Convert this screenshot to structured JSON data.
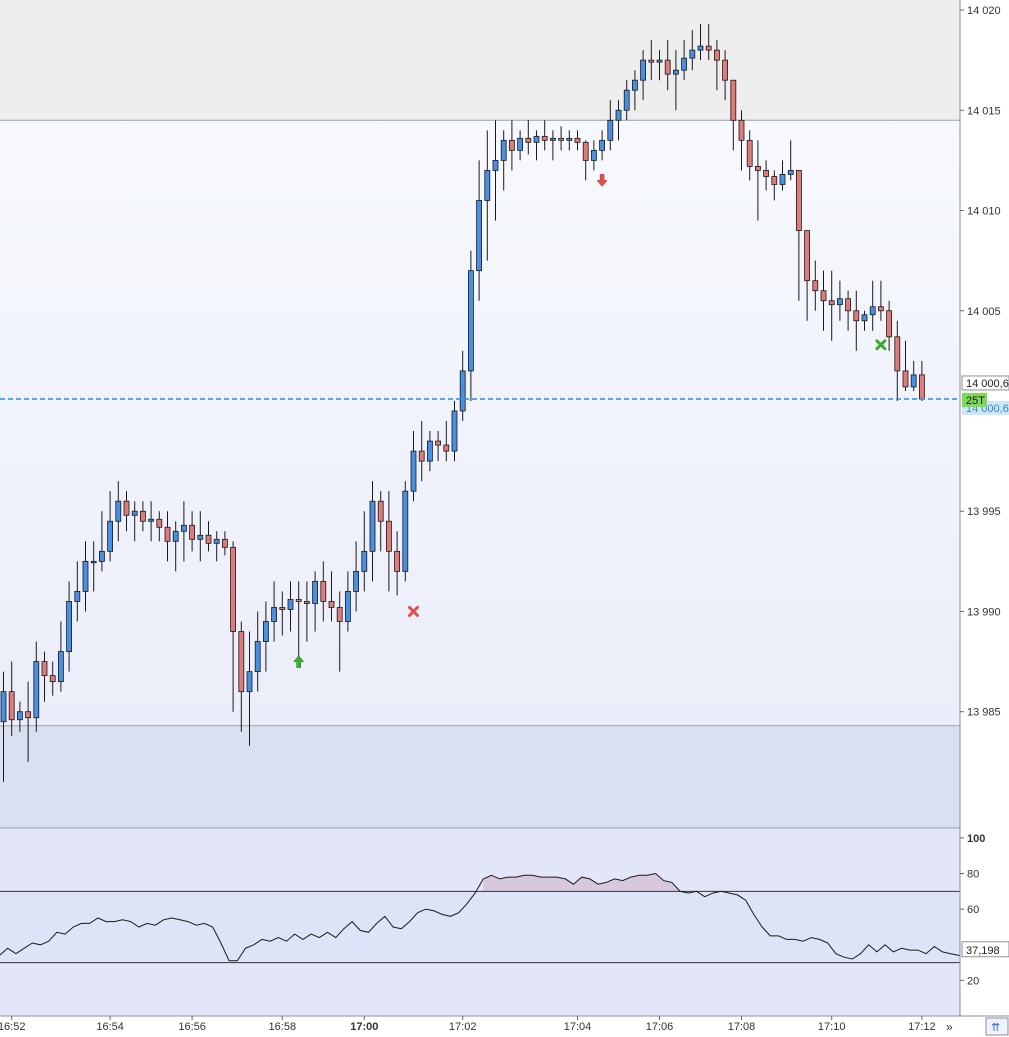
{
  "chart_data": [
    {
      "type": "candlestick",
      "symbol_tag": "25T",
      "y_ticks": [
        "14 020",
        "14 015",
        "14 010",
        "14 005",
        "13 995",
        "13 990",
        "13 985"
      ],
      "y_tick_values": [
        14020,
        14015,
        14010,
        14005,
        13995,
        13990,
        13985
      ],
      "ylim": [
        13979.2,
        14020.5
      ],
      "x_ticks": [
        {
          "label": "16:52",
          "bar": 1,
          "bold": false
        },
        {
          "label": "16:54",
          "bar": 13,
          "bold": false
        },
        {
          "label": "16:56",
          "bar": 23,
          "bold": false
        },
        {
          "label": "16:58",
          "bar": 34,
          "bold": false
        },
        {
          "label": "17:00",
          "bar": 44,
          "bold": true
        },
        {
          "label": "17:02",
          "bar": 56,
          "bold": false
        },
        {
          "label": "17:04",
          "bar": 70,
          "bold": false
        },
        {
          "label": "17:06",
          "bar": 80,
          "bold": false
        },
        {
          "label": "17:08",
          "bar": 90,
          "bold": false
        },
        {
          "label": "17:10",
          "bar": 101,
          "bold": false
        },
        {
          "label": "17:12",
          "bar": 112,
          "bold": false
        }
      ],
      "last_price": "14 000,6",
      "last_price_value": 14000.6,
      "upper_zone_from": 14014.5,
      "lower_zone_to": 13984.3,
      "colors": {
        "up": "#4a90e2",
        "down": "#e07b7b",
        "outline": "#1a1a1a",
        "level": "#2a8bd8",
        "tag": "#7ed957"
      },
      "candles": [
        [
          13984.5,
          13987.0,
          13981.5,
          13986.0
        ],
        [
          13986.0,
          13987.5,
          13983.8,
          13984.6
        ],
        [
          13984.6,
          13985.5,
          13984.0,
          13985.0
        ],
        [
          13985.0,
          13986.5,
          13982.5,
          13984.7
        ],
        [
          13984.7,
          13988.5,
          13984.0,
          13987.5
        ],
        [
          13987.5,
          13988.0,
          13985.5,
          13986.8
        ],
        [
          13986.8,
          13987.5,
          13985.8,
          13986.5
        ],
        [
          13986.5,
          13989.5,
          13986.0,
          13988.0
        ],
        [
          13988.0,
          13991.5,
          13987.0,
          13990.5
        ],
        [
          13990.5,
          13992.5,
          13989.5,
          13991.0
        ],
        [
          13991.0,
          13993.5,
          13990.0,
          13992.5
        ],
        [
          13992.5,
          13993.5,
          13991.0,
          13992.5
        ],
        [
          13992.5,
          13995.0,
          13992.0,
          13993.0
        ],
        [
          13993.0,
          13996.0,
          13992.5,
          13994.5
        ],
        [
          13994.5,
          13996.5,
          13993.5,
          13995.5
        ],
        [
          13995.5,
          13996.0,
          13994.0,
          13994.8
        ],
        [
          13994.8,
          13995.5,
          13993.5,
          13995.0
        ],
        [
          13995.0,
          13995.5,
          13994.0,
          13994.5
        ],
        [
          13994.5,
          13995.5,
          13993.5,
          13994.6
        ],
        [
          13994.6,
          13995.0,
          13993.5,
          13994.2
        ],
        [
          13994.2,
          13995.0,
          13992.5,
          13993.5
        ],
        [
          13993.5,
          13994.5,
          13992.0,
          13994.0
        ],
        [
          13994.0,
          13995.5,
          13992.5,
          13994.3
        ],
        [
          13994.3,
          13995.0,
          13993.0,
          13993.6
        ],
        [
          13993.6,
          13995.0,
          13992.5,
          13993.8
        ],
        [
          13993.8,
          13994.5,
          13993.0,
          13993.4
        ],
        [
          13993.4,
          13994.0,
          13992.5,
          13993.6
        ],
        [
          13993.6,
          13994.0,
          13992.8,
          13993.2
        ],
        [
          13993.2,
          13993.5,
          13985.0,
          13989.0
        ],
        [
          13989.0,
          13989.5,
          13984.0,
          13986.0
        ],
        [
          13986.0,
          13989.0,
          13983.3,
          13987.0
        ],
        [
          13987.0,
          13990.0,
          13986.0,
          13988.5
        ],
        [
          13988.5,
          13990.5,
          13987.0,
          13989.5
        ],
        [
          13989.5,
          13991.5,
          13988.5,
          13990.2
        ],
        [
          13990.2,
          13991.0,
          13988.8,
          13990.1
        ],
        [
          13990.1,
          13991.5,
          13989.0,
          13990.6
        ],
        [
          13990.6,
          13991.5,
          13987.5,
          13990.5
        ],
        [
          13990.5,
          13991.5,
          13988.5,
          13990.4
        ],
        [
          13990.4,
          13992.0,
          13989.0,
          13991.5
        ],
        [
          13991.5,
          13992.5,
          13989.5,
          13990.5
        ],
        [
          13990.5,
          13992.0,
          13989.5,
          13990.2
        ],
        [
          13990.2,
          13991.0,
          13987.0,
          13989.5
        ],
        [
          13989.5,
          13992.0,
          13989.0,
          13991.0
        ],
        [
          13991.0,
          13993.5,
          13990.0,
          13992.0
        ],
        [
          13992.0,
          13995.0,
          13991.0,
          13993.0
        ],
        [
          13993.0,
          13996.5,
          13991.5,
          13995.5
        ],
        [
          13995.5,
          13996.0,
          13993.0,
          13994.5
        ],
        [
          13994.5,
          13996.0,
          13991.0,
          13993.0
        ],
        [
          13993.0,
          13994.0,
          13990.8,
          13992.0
        ],
        [
          13992.0,
          13996.5,
          13991.5,
          13996.0
        ],
        [
          13996.0,
          13999.0,
          13995.5,
          13998.0
        ],
        [
          13998.0,
          13999.5,
          13996.5,
          13997.5
        ],
        [
          13997.5,
          13999.0,
          13997.0,
          13998.5
        ],
        [
          13998.5,
          13999.0,
          13997.5,
          13998.3
        ],
        [
          13998.3,
          13999.5,
          13997.5,
          13998.0
        ],
        [
          13998.0,
          14000.5,
          13997.5,
          14000.0
        ],
        [
          14000.0,
          14003.0,
          13999.5,
          14002.0
        ],
        [
          14002.0,
          14008.0,
          14000.5,
          14007.0
        ],
        [
          14007.0,
          14012.5,
          14005.5,
          14010.5
        ],
        [
          14010.5,
          14014.0,
          14007.5,
          14012.0
        ],
        [
          14012.0,
          14014.5,
          14009.5,
          14012.5
        ],
        [
          14012.5,
          14014.0,
          14011.0,
          14013.5
        ],
        [
          14013.5,
          14014.5,
          14012.0,
          14013.0
        ],
        [
          14013.0,
          14014.0,
          14012.5,
          14013.6
        ],
        [
          14013.6,
          14014.5,
          14012.8,
          14013.4
        ],
        [
          14013.4,
          14014.0,
          14012.5,
          14013.7
        ],
        [
          14013.7,
          14014.5,
          14013.0,
          14013.5
        ],
        [
          14013.5,
          14014.0,
          14012.5,
          14013.6
        ],
        [
          14013.6,
          14014.2,
          14013.0,
          14013.5
        ],
        [
          14013.5,
          14014.0,
          14013.0,
          14013.6
        ],
        [
          14013.6,
          14014.0,
          14013.0,
          14013.4
        ],
        [
          14013.4,
          14013.5,
          14011.5,
          14012.5
        ],
        [
          14012.5,
          14013.5,
          14012.0,
          14013.0
        ],
        [
          14013.0,
          14014.0,
          14012.5,
          14013.5
        ],
        [
          14013.5,
          14015.5,
          14013.0,
          14014.5
        ],
        [
          14014.5,
          14015.5,
          14013.5,
          14015.0
        ],
        [
          14015.0,
          14016.5,
          14014.5,
          14016.0
        ],
        [
          14016.0,
          14017.0,
          14015.0,
          14016.5
        ],
        [
          14016.5,
          14018.0,
          14015.5,
          14017.5
        ],
        [
          14017.5,
          14018.5,
          14016.5,
          14017.4
        ],
        [
          14017.4,
          14018.0,
          14016.5,
          14017.5
        ],
        [
          14017.5,
          14018.5,
          14016.0,
          14016.8
        ],
        [
          14016.8,
          14018.0,
          14015.0,
          14017.0
        ],
        [
          14017.0,
          14018.5,
          14016.5,
          14017.6
        ],
        [
          14017.6,
          14019.0,
          14017.0,
          14018.0
        ],
        [
          14018.0,
          14019.3,
          14017.5,
          14018.2
        ],
        [
          14018.2,
          14019.3,
          14017.5,
          14018.0
        ],
        [
          14018.0,
          14018.5,
          14016.0,
          14017.5
        ],
        [
          14017.5,
          14018.0,
          14015.5,
          14016.5
        ],
        [
          14016.5,
          14016.5,
          14013.0,
          14014.5
        ],
        [
          14014.5,
          14015.0,
          14012.0,
          14013.5
        ],
        [
          14013.5,
          14014.0,
          14011.5,
          14012.2
        ],
        [
          14012.2,
          14013.5,
          14009.5,
          14012.0
        ],
        [
          14012.0,
          14012.5,
          14011.0,
          14011.7
        ],
        [
          14011.7,
          14012.0,
          14010.5,
          14011.3
        ],
        [
          14011.3,
          14012.5,
          14011.0,
          14011.8
        ],
        [
          14011.8,
          14013.5,
          14011.5,
          14012.0
        ],
        [
          14012.0,
          14012.0,
          14005.5,
          14009.0
        ],
        [
          14009.0,
          14009.0,
          14004.5,
          14006.5
        ],
        [
          14006.5,
          14007.5,
          14005.0,
          14006.0
        ],
        [
          14006.0,
          14007.0,
          14004.0,
          14005.5
        ],
        [
          14005.5,
          14007.0,
          14003.5,
          14005.3
        ],
        [
          14005.3,
          14006.5,
          14004.5,
          14005.6
        ],
        [
          14005.6,
          14006.0,
          14004.0,
          14005.0
        ],
        [
          14005.0,
          14006.0,
          14003.0,
          14004.5
        ],
        [
          14004.5,
          14005.0,
          14004.0,
          14004.8
        ],
        [
          14004.8,
          14006.5,
          14004.0,
          14005.2
        ],
        [
          14005.2,
          14006.5,
          14004.5,
          14005.0
        ],
        [
          14005.0,
          14005.5,
          14003.0,
          14003.7
        ],
        [
          14003.7,
          14004.5,
          14000.5,
          14002.0
        ],
        [
          14002.0,
          14003.5,
          14001.0,
          14001.2
        ],
        [
          14001.2,
          14002.5,
          14001.0,
          14001.8
        ],
        [
          14001.8,
          14002.5,
          14000.5,
          14000.6
        ]
      ],
      "annotations": [
        {
          "type": "buy-arrow",
          "bar": 36,
          "price": 13987.5,
          "color": "#3aaa35"
        },
        {
          "type": "sell-arrow",
          "bar": 73,
          "price": 14011.5,
          "color": "#e05050"
        },
        {
          "type": "cross",
          "bar": 50,
          "price": 13990.0,
          "color": "#e05050"
        },
        {
          "type": "cross",
          "bar": 107,
          "price": 14003.3,
          "color": "#3aaa35"
        }
      ]
    },
    {
      "type": "line",
      "y_ticks": [
        "100",
        "80",
        "60",
        "20"
      ],
      "y_tick_values": [
        100,
        80,
        60,
        20
      ],
      "ylim": [
        0,
        105
      ],
      "upper_band": 70,
      "lower_band": 30,
      "last_value": "37,198",
      "last_value_num": 37.198,
      "colors": {
        "line": "#1a1a1a",
        "band": "#333333",
        "fill": "#d8c8de",
        "fill_stroke": "#9a7fa8"
      },
      "values": [
        34,
        38,
        35,
        38,
        41,
        40,
        42,
        47,
        46,
        50,
        52,
        52,
        55,
        53,
        53,
        54,
        53,
        50,
        52,
        51,
        54,
        55,
        54,
        53,
        51,
        52,
        50,
        41,
        31,
        31,
        38,
        40,
        43,
        42,
        44,
        42,
        46,
        43,
        46,
        44,
        47,
        44,
        49,
        53,
        48,
        47,
        52,
        56,
        50,
        49,
        53,
        58,
        60,
        59,
        57,
        56,
        58,
        63,
        69,
        77,
        79,
        77,
        78,
        78,
        79,
        79,
        78,
        78,
        78,
        77,
        74,
        78,
        77,
        74,
        75,
        77,
        76,
        78,
        79,
        79,
        80,
        76,
        75,
        70,
        69,
        70,
        67,
        69,
        70,
        69,
        68,
        65,
        57,
        50,
        45,
        45,
        43,
        43,
        42,
        44,
        43,
        41,
        35,
        33,
        32,
        35,
        40,
        36,
        40,
        36,
        38,
        37,
        37,
        35,
        39,
        36,
        35,
        34,
        35,
        37,
        35,
        37,
        36,
        37
      ]
    }
  ],
  "ui": {
    "scroll_right_label": "»",
    "expand_label": "⇈"
  }
}
